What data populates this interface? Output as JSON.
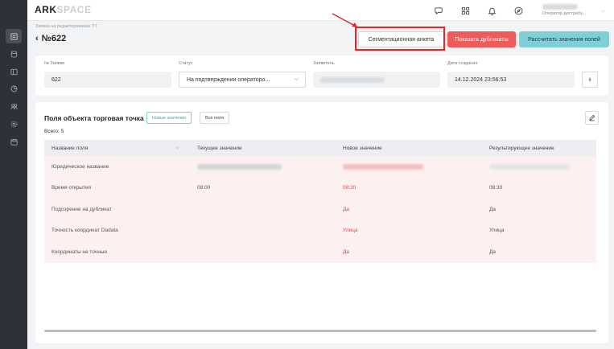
{
  "app": {
    "logo_main": "ARK",
    "logo_accent": "SPACE"
  },
  "user": {
    "role": "Оператор дистрибу..."
  },
  "breadcrumb": "Заявка на редактирование ТТ",
  "page_title": "№622",
  "actions": {
    "segment_label": "Сегментационная анкета",
    "duplicates_label": "Показать дубликаты",
    "calc_label": "Рассчитать значения полей"
  },
  "colors": {
    "danger": "#ef5b5b",
    "accent": "#7ecfd6",
    "annotation": "#e32626"
  },
  "request": {
    "number_label": "№ Заявки",
    "number_value": "622",
    "status_label": "Статус",
    "status_value": "На подтверждении операторо...",
    "applicant_label": "Заявитель",
    "created_label": "Дата создания",
    "created_value": "14.12.2024 23:56:53"
  },
  "section": {
    "title": "Поля объекта торговая точка",
    "tab_new": "Новые значения",
    "tab_all": "Все поля",
    "total": "Всего: 5"
  },
  "table": {
    "headers": [
      "Название поля",
      "Текущее значение",
      "Новое значение",
      "Результирующее значение"
    ],
    "rows": [
      {
        "name": "Юридическое название",
        "current": "",
        "new": "",
        "result": ""
      },
      {
        "name": "Время открытия",
        "current": "08:00",
        "new": "08:30",
        "result": "08:30"
      },
      {
        "name": "Подозрение на дубликат",
        "current": "",
        "new": "Да",
        "result": "Да"
      },
      {
        "name": "Точность координат Dadata",
        "current": "",
        "new": "Улица",
        "result": "Улица"
      },
      {
        "name": "Координаты не точные",
        "current": "",
        "new": "Да",
        "result": "Да"
      }
    ]
  }
}
